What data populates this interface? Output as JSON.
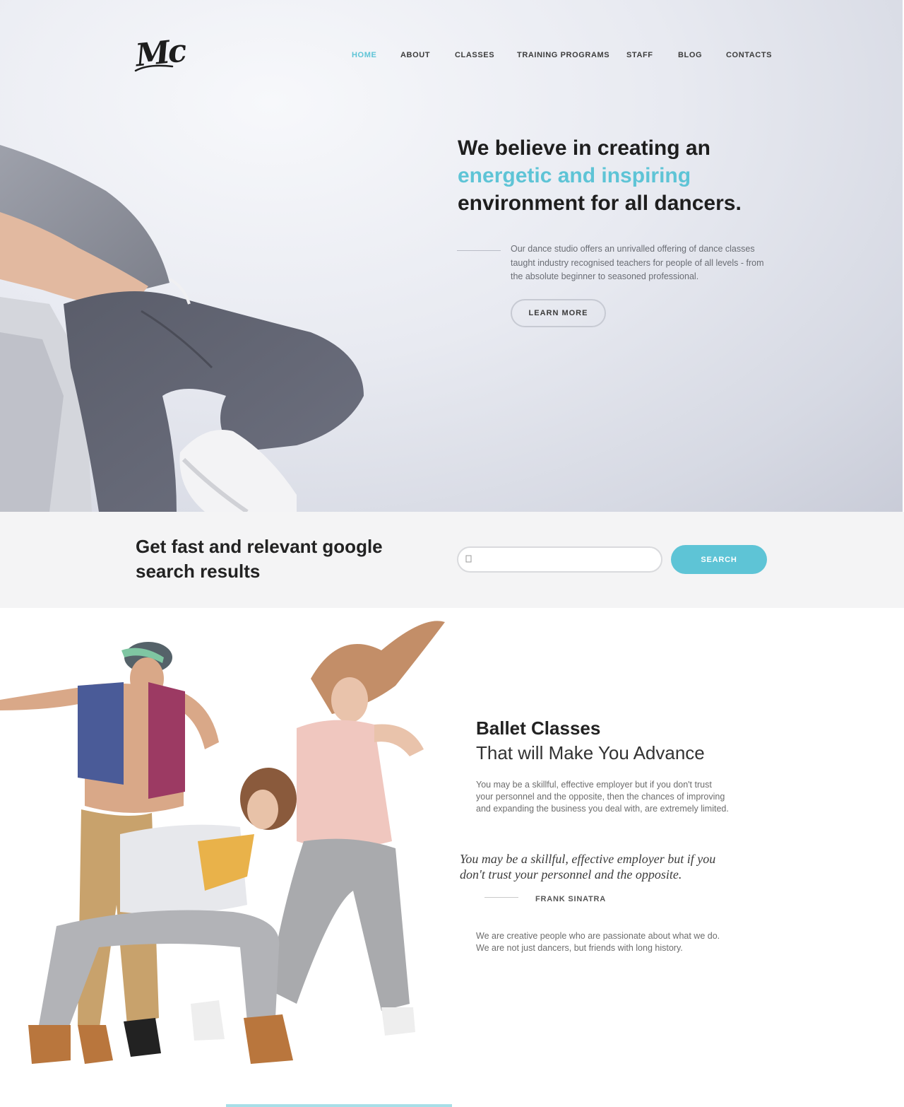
{
  "brand": {
    "logo_text": "Mc"
  },
  "nav": {
    "items": [
      {
        "label": "HOME",
        "active": true
      },
      {
        "label": "ABOUT",
        "active": false
      },
      {
        "label": "CLASSES",
        "active": false
      },
      {
        "label": "TRAINING PROGRAMS",
        "active": false
      },
      {
        "label": "STAFF",
        "active": false
      },
      {
        "label": "BLOG",
        "active": false
      },
      {
        "label": "CONTACTS",
        "active": false
      }
    ]
  },
  "hero": {
    "title_line1": "We believe in creating an",
    "title_accent": "energetic and inspiring",
    "title_line3": "environment for all dancers.",
    "description": "Our dance studio offers an unrivalled offering of dance classes taught industry recognised teachers for people of all levels - from the absolute beginner to seasoned professional.",
    "button_label": "LEARN MORE"
  },
  "search": {
    "title": "Get fast and relevant google search results",
    "input_value": "",
    "button_label": "SEARCH"
  },
  "ballet": {
    "title": "Ballet Classes",
    "subtitle": "That will Make You Advance",
    "paragraph1": "You may be a skillful, effective employer but if you don't trust your personnel and the opposite, then the chances of improving and expanding the business you deal with, are extremely limited.",
    "quote": "You may be a skillful, effective employer but if you don't trust your personnel and the opposite.",
    "quote_author": "FRANK SINATRA",
    "paragraph2": "We are creative people who are passionate about what we do. We are not just dancers, but friends with long history."
  },
  "colors": {
    "accent": "#5ec4d6",
    "text_dark": "#222222",
    "band_bg": "#f4f4f5"
  },
  "icons": {
    "search": "search-icon"
  }
}
